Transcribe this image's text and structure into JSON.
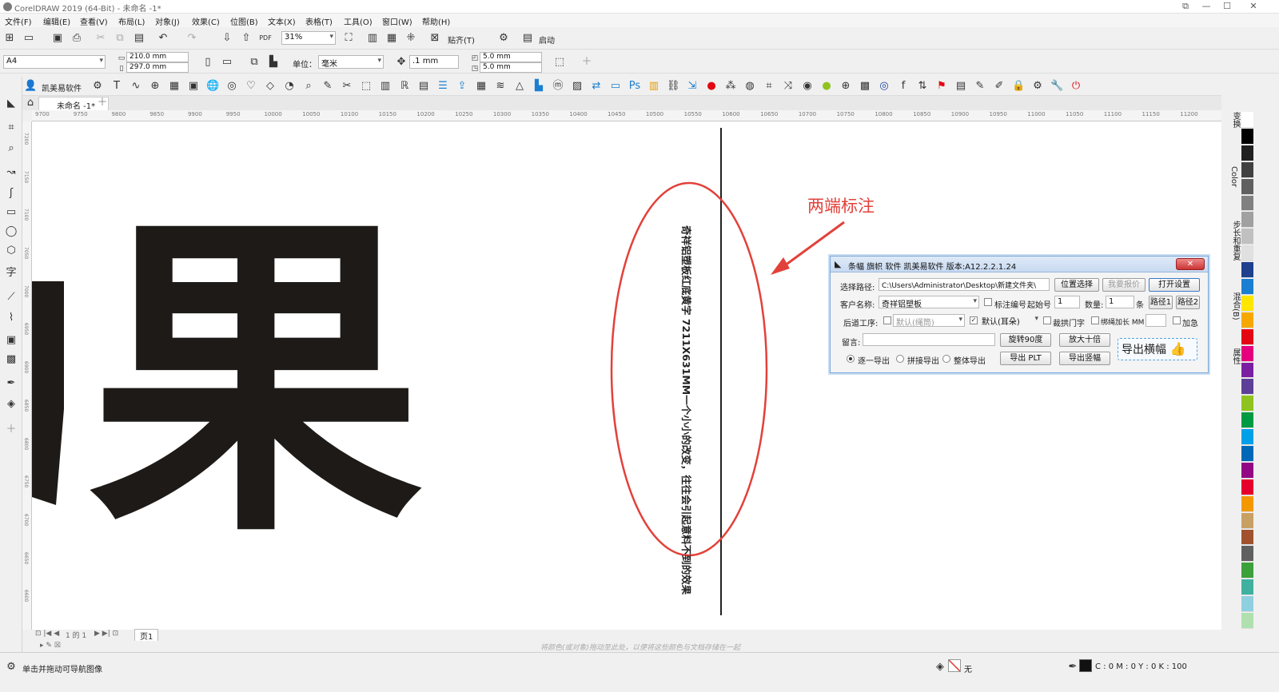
{
  "app": {
    "title": "CorelDRAW 2019 (64-Bit) - 未命名 -1*"
  },
  "menu": [
    "文件(F)",
    "编辑(E)",
    "查看(V)",
    "布局(L)",
    "对象(J)",
    "效果(C)",
    "位图(B)",
    "文本(X)",
    "表格(T)",
    "工具(O)",
    "窗口(W)",
    "帮助(H)"
  ],
  "toolbar1": {
    "zoom": "31%",
    "snap_label": "贴齐(T)",
    "launch_label": "启动"
  },
  "toolbar2": {
    "page_size": "A4",
    "width": "210.0 mm",
    "height": "297.0 mm",
    "unit_label": "单位：",
    "unit_value": "毫米",
    "nudge": ".1 mm",
    "dup_x": "5.0 mm",
    "dup_y": "5.0 mm"
  },
  "toolbar3": {
    "plugin_label": "凯美易软件"
  },
  "doc_tab": {
    "name": "未命名 -1*"
  },
  "ruler": {
    "h_ticks": [
      "9700",
      "9750",
      "9800",
      "9850",
      "9900",
      "9950",
      "10000",
      "10050",
      "10100",
      "10150",
      "10200",
      "10250",
      "10300",
      "10350",
      "10400",
      "10450",
      "10500",
      "10550",
      "10600",
      "10650",
      "10700",
      "10750",
      "10800",
      "10850",
      "10900",
      "10950",
      "11000",
      "11050",
      "11100",
      "11150",
      "11200"
    ],
    "v_ticks": [
      "7200",
      "7150",
      "7100",
      "7050",
      "7000",
      "6950",
      "6900",
      "6850",
      "6800",
      "6750",
      "6700",
      "6650",
      "6600"
    ]
  },
  "canvas": {
    "big_char": "果",
    "vertical_text": "奇祥铝塑板红底黄字 7211X631MM一个小小的改变，往往会引起意料不到的效果",
    "annotation": "两端标注",
    "accent_red": "#e2413a"
  },
  "dialog": {
    "title": "条幅  旗帜  软件  凯美易软件  版本:A12.2.2.1.24",
    "path_label": "选择路径:",
    "path_value": "C:\\Users\\Administrator\\Desktop\\新建文件夹\\",
    "btn_locate": "位置选择",
    "btn_quote": "我要报价",
    "btn_open_settings": "打开设置",
    "customer_label": "客户名称:",
    "customer_value": "奇祥铝塑板",
    "mark_number_label": "标注编号",
    "start_number_label": "起始号",
    "start_number_value": "1",
    "count_label": "数量:",
    "count_value": "1",
    "count_unit": "条",
    "btn_path1": "路径1",
    "btn_path2": "路径2",
    "post_label": "后道工序:",
    "post_default": "默认(绳筒)",
    "post_ear": "默认(耳朵)",
    "arch_label": "裁拱门字",
    "rope_label": "绑绳加长 MM",
    "extra_label": "加急",
    "note_label": "留言:",
    "btn_rotate": "旋转90度",
    "btn_enlarge": "放大十倍",
    "btn_export_plt": "导出 PLT",
    "btn_export_vertical": "导出竖幅",
    "radio_each": "逐一导出",
    "radio_join": "拼接导出",
    "radio_whole": "整体导出",
    "btn_export_horizontal": "导出横幅"
  },
  "page_nav": {
    "text": "1 的 1",
    "page_tab": "页1",
    "hint": "将颜色(或对象)拖动至此处，以便将这些颜色与文档存储在一起"
  },
  "status": {
    "hint": "单击并拖动可导航图像",
    "fill_label": "无",
    "color_info": "C : 0 M : 0 Y : 0 K : 100"
  },
  "right_panel": [
    "变换",
    "Color",
    "步长和重复",
    "混合(B)",
    "属性"
  ],
  "palette": [
    "#ffffff",
    "#000000",
    "#202020",
    "#404040",
    "#606060",
    "#808080",
    "#a0a0a0",
    "#c0c0c0",
    "#e0e0e0",
    "#1f3f8f",
    "#1a7fd1",
    "#ffe600",
    "#f6a800",
    "#e30613",
    "#e5007d",
    "#7a1fa2",
    "#5e3f98",
    "#8fc31f",
    "#009944",
    "#00a0e9",
    "#0068b7",
    "#920783",
    "#e6002d",
    "#f39800",
    "#c8a063",
    "#a0522d",
    "#606060",
    "#3ca03c",
    "#40b0a0",
    "#8fd0e0",
    "#b0e0b0"
  ]
}
